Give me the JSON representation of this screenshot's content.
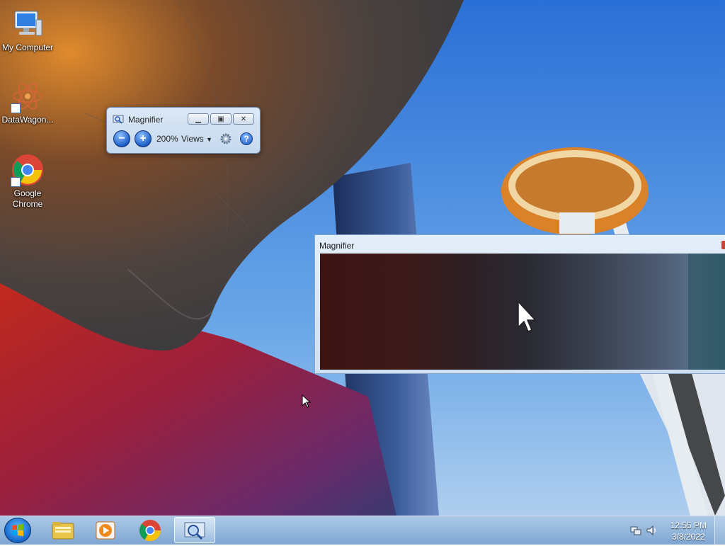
{
  "desktop": {
    "icons": [
      {
        "label": "My Computer",
        "icon": "computer-icon"
      },
      {
        "label": "DataWagon...",
        "icon": "datawagon-icon"
      },
      {
        "label_line1": "Google",
        "label_line2": "Chrome",
        "icon": "chrome-icon"
      }
    ]
  },
  "magnifier_toolbar": {
    "title": "Magnifier",
    "zoom_out_symbol": "−",
    "zoom_in_symbol": "+",
    "zoom_level": "200%",
    "views_label": "Views",
    "views_arrow": "▼",
    "help_symbol": "?",
    "minimize_symbol": "▁",
    "restore_symbol": "▣",
    "close_symbol": "✕"
  },
  "magnifier_window": {
    "title": "Magnifier"
  },
  "taskbar": {
    "items": [
      "windows-explorer",
      "media-player",
      "google-chrome",
      "magnifier"
    ],
    "active_item": "magnifier"
  },
  "tray": {
    "time": "12:55 PM",
    "date": "3/8/2022"
  },
  "colors": {
    "taskbar_blue": "#8fb4dc",
    "accent_blue": "#1d5fc7",
    "close_red": "#c8463a"
  }
}
